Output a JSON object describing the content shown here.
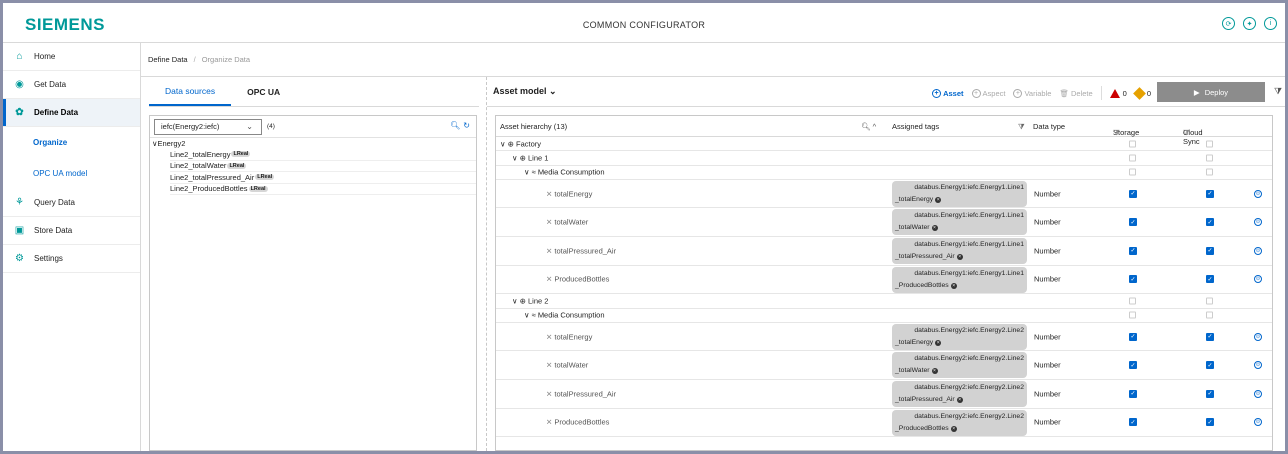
{
  "brand": "SIEMENS",
  "app_title": "COMMON CONFIGURATOR",
  "top_icons": [
    "history-icon",
    "plugin-icon",
    "info-icon"
  ],
  "sidebar": {
    "items": [
      {
        "label": "Home",
        "icon": "home-icon"
      },
      {
        "label": "Get Data",
        "icon": "get-data-icon"
      },
      {
        "label": "Define Data",
        "icon": "define-data-icon",
        "active": true
      },
      {
        "label": "Query Data",
        "icon": "query-data-icon"
      },
      {
        "label": "Store Data",
        "icon": "store-data-icon"
      },
      {
        "label": "Settings",
        "icon": "settings-icon"
      }
    ],
    "subitems": [
      {
        "label": "Organize",
        "active": true
      },
      {
        "label": "OPC UA model"
      }
    ]
  },
  "breadcrumb": [
    "Define Data",
    "Organize Data"
  ],
  "left": {
    "tabs": [
      "Data sources",
      "OPC UA"
    ],
    "source_select": "iefc(Energy2:iefc)",
    "source_count": "(4)",
    "tree_root": "Energy2",
    "type_badge": "LReal",
    "tags": [
      "Line2_totalEnergy",
      "Line2_totalWater",
      "Line2_totalPressured_Air",
      "Line2_ProducedBottles"
    ]
  },
  "right": {
    "title": "Asset model",
    "actions": {
      "asset": "Asset",
      "aspect": "Aspect",
      "variable": "Variable",
      "delete": "Delete"
    },
    "error_count": "0",
    "warning_count": "0",
    "deploy": "Deploy",
    "columns": {
      "hierarchy": "Asset hierarchy (13)",
      "tags": "Assigned tags",
      "type": "Data type",
      "storage": "Storage",
      "cloud": "Cloud Sync"
    },
    "rows": [
      {
        "kind": "asset",
        "level": 0,
        "label": "Factory"
      },
      {
        "kind": "asset",
        "level": 1,
        "label": "Line 1"
      },
      {
        "kind": "aspect",
        "level": 2,
        "label": "Media Consumption"
      },
      {
        "kind": "var",
        "label": "totalEnergy",
        "tag1": "databus.Energy1:iefc.Energy1.Line1",
        "tag2": "_totalEnergy",
        "type": "Number"
      },
      {
        "kind": "var",
        "label": "totalWater",
        "tag1": "databus.Energy1:iefc.Energy1.Line1",
        "tag2": "_totalWater",
        "type": "Number"
      },
      {
        "kind": "var",
        "label": "totalPressured_Air",
        "tag1": "databus.Energy1:iefc.Energy1.Line1",
        "tag2": "_totalPressured_Air",
        "type": "Number"
      },
      {
        "kind": "var",
        "label": "ProducedBottles",
        "tag1": "databus.Energy1:iefc.Energy1.Line1",
        "tag2": "_ProducedBottles",
        "type": "Number"
      },
      {
        "kind": "asset",
        "level": 1,
        "label": "Line 2"
      },
      {
        "kind": "aspect",
        "level": 2,
        "label": "Media Consumption"
      },
      {
        "kind": "var",
        "label": "totalEnergy",
        "tag1": "databus.Energy2:iefc.Energy2.Line2",
        "tag2": "_totalEnergy",
        "type": "Number"
      },
      {
        "kind": "var",
        "label": "totalWater",
        "tag1": "databus.Energy2:iefc.Energy2.Line2",
        "tag2": "_totalWater",
        "type": "Number"
      },
      {
        "kind": "var",
        "label": "totalPressured_Air",
        "tag1": "databus.Energy2:iefc.Energy2.Line2",
        "tag2": "_totalPressured_Air",
        "type": "Number"
      },
      {
        "kind": "var",
        "label": "ProducedBottles",
        "tag1": "databus.Energy2:iefc.Energy2.Line2",
        "tag2": "_ProducedBottles",
        "type": "Number"
      }
    ]
  }
}
